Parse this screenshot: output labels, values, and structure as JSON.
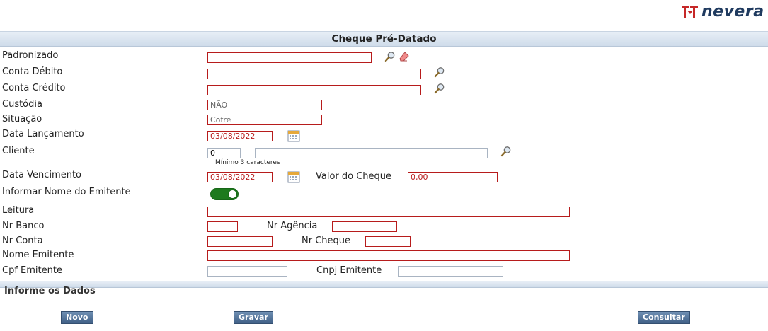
{
  "brand": {
    "name": "nevera",
    "color": "#1f3a5f",
    "accent": "#c62828"
  },
  "form": {
    "title": "Cheque Pré-Datado",
    "fields": {
      "padronizado": {
        "label": "Padronizado",
        "value": ""
      },
      "conta_debito": {
        "label": "Conta Débito",
        "value": ""
      },
      "conta_credito": {
        "label": "Conta Crédito",
        "value": ""
      },
      "custodia": {
        "label": "Custódia",
        "value": "NÃO"
      },
      "situacao": {
        "label": "Situação",
        "value": "Cofre"
      },
      "data_lancamento": {
        "label": "Data Lançamento",
        "value": "03/08/2022"
      },
      "cliente": {
        "label": "Cliente",
        "code": "0",
        "name": "",
        "hint": "Mínimo 3 caracteres"
      },
      "data_vencimento": {
        "label": "Data Vencimento",
        "value": "03/08/2022"
      },
      "valor_cheque": {
        "label": "Valor do Cheque",
        "value": "0,00"
      },
      "informar_nome": {
        "label": "Informar Nome do Emitente",
        "checked": true
      },
      "leitura": {
        "label": "Leitura",
        "value": ""
      },
      "nr_banco": {
        "label": "Nr Banco",
        "value": ""
      },
      "nr_agencia": {
        "label": "Nr Agência",
        "value": ""
      },
      "nr_conta": {
        "label": "Nr Conta",
        "value": ""
      },
      "nr_cheque": {
        "label": "Nr Cheque",
        "value": ""
      },
      "nome_emitente": {
        "label": "Nome Emitente",
        "value": ""
      },
      "cpf_emitente": {
        "label": "Cpf Emitente",
        "value": ""
      },
      "cnpj_emitente": {
        "label": "Cnpj Emitente",
        "value": ""
      }
    }
  },
  "footer": {
    "section_title": "Informe os Dados",
    "buttons": {
      "novo": "Novo",
      "gravar": "Gravar",
      "consultar": "Consultar"
    }
  },
  "colors": {
    "required_border": "#b71c1c",
    "toggle_on": "#1d7a1d",
    "button": "#3f5f86"
  }
}
